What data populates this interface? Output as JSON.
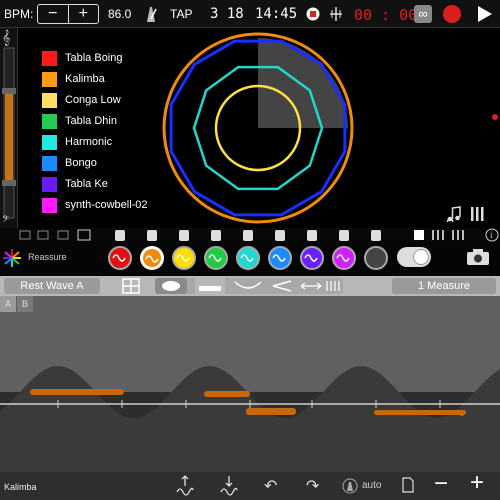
{
  "topbar": {
    "bpm_label": "BPM:",
    "minus": "−",
    "plus": "+",
    "bpm_value": "86.0",
    "tap_label": "TAP",
    "time_sig": "3 18",
    "clock": "14:45",
    "timer": "00 : 00",
    "loop_label": "∞"
  },
  "legend": [
    {
      "label": "Tabla Boing",
      "color": "#ff1a1a"
    },
    {
      "label": "Kalimba",
      "color": "#ff9a14"
    },
    {
      "label": "Conga Low",
      "color": "#ffe066"
    },
    {
      "label": "Tabla Dhin",
      "color": "#22cc55"
    },
    {
      "label": "Harmonic",
      "color": "#22e8e0"
    },
    {
      "label": "Bongo",
      "color": "#1a8cff"
    },
    {
      "label": "Tabla Ke",
      "color": "#6a1aff"
    },
    {
      "label": "synth-cowbell-02",
      "color": "#ff1aff"
    }
  ],
  "instruments": {
    "reassure_label": "Reassure",
    "colors": [
      "#e01010",
      "#f08a10",
      "#ffdd00",
      "#20cc40",
      "#20d8d0",
      "#1a8cff",
      "#6a20ff",
      "#d020ff",
      "#444444"
    ]
  },
  "editor": {
    "wave_name": "Rest Wave A",
    "measure_label": "1 Measure",
    "tab_a": "A",
    "tab_b": "B",
    "instrument_name": "Kalimba",
    "auto_label": "auto"
  },
  "colors": {
    "accent_orange": "#f08a10",
    "record_red": "#e51d1d"
  }
}
